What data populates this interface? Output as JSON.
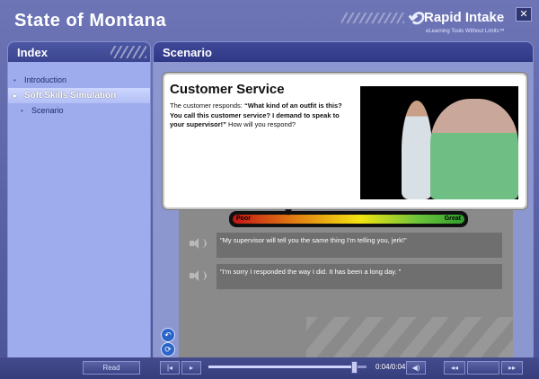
{
  "app": {
    "title": "State of Montana",
    "logo_name": "Rapid Intake",
    "logo_tagline": "eLearning Tools Without Limits™",
    "close_icon": "close-icon"
  },
  "index": {
    "title": "Index",
    "items": [
      {
        "label": "Introduction",
        "level": 1,
        "selected": false
      },
      {
        "label": "Soft Skills Simulation",
        "level": 1,
        "selected": true
      },
      {
        "label": "Scenario",
        "level": 2,
        "selected": false
      }
    ]
  },
  "scenario": {
    "title": "Scenario",
    "card_title": "Customer Service",
    "prompt_intro": "The customer responds: ",
    "prompt_quote": "“What kind of an outfit is this? You call this customer service? I demand to speak to your supervisor!”",
    "prompt_question": " How will you respond?",
    "meter_poor": "Poor",
    "meter_great": "Great",
    "meter_level": 0.24,
    "options": [
      "\"My supervisor will tell you the same thing I'm telling you, jerk!\"",
      "\"I'm sorry I responded the way I did. It has been a long day. \""
    ]
  },
  "player": {
    "read_label": "Read",
    "time": "0:04/0:04",
    "progress": 0.92,
    "colors": {
      "accent": "#4c57a3",
      "panel": "#9eacee"
    }
  }
}
